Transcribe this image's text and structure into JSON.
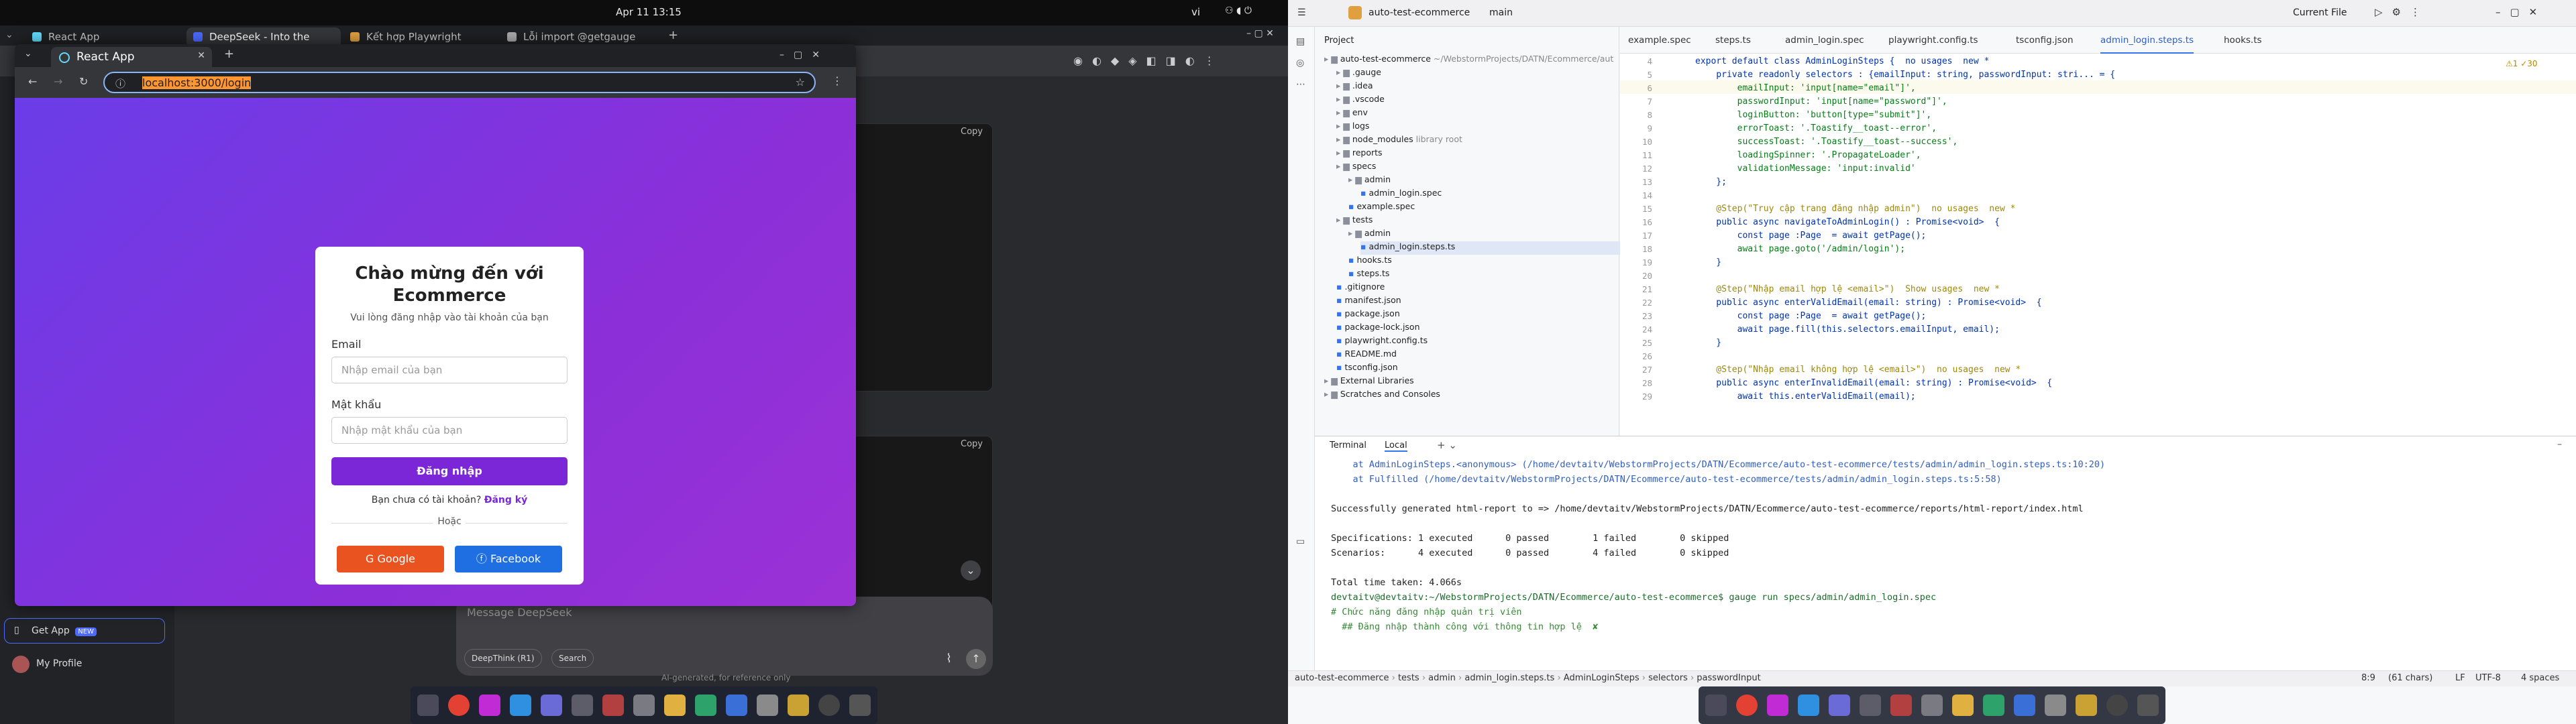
{
  "topbar": {
    "clock": "Apr 11  13:15",
    "lang": "vi"
  },
  "browser": {
    "tabs": [
      {
        "label": "React App",
        "color": "#61dafb"
      },
      {
        "label": "DeepSeek - Into the",
        "color": "#4d6bfe"
      },
      {
        "label": "Kết hợp Playwright",
        "color": "#e0a040"
      },
      {
        "label": "Lỗi import @getgauge",
        "color": "#aaaaaa"
      }
    ],
    "deepseek": {
      "copy_label": "Copy",
      "copy_label2": "Copy",
      "message_placeholder": "Message DeepSeek",
      "deepthink_label": "DeepThink (R1)",
      "search_label": "Search",
      "footer_note": "AI-generated, for reference only",
      "get_app_label": "Get App",
      "new_badge": "NEW",
      "profile_label": "My Profile"
    }
  },
  "popup": {
    "tab_title": "React App",
    "url": "localhost:3000/login",
    "login": {
      "title": "Chào mừng đến với Ecommerce",
      "subtitle": "Vui lòng đăng nhập vào tài khoản của bạn",
      "email_label": "Email",
      "email_placeholder": "Nhập email của bạn",
      "password_label": "Mật khẩu",
      "password_placeholder": "Nhập mật khẩu của bạn",
      "submit_label": "Đăng nhập",
      "no_account_text": "Bạn chưa có tài khoản?",
      "register_link": "Đăng ký",
      "or_text": "Hoặc",
      "google_label": "Google",
      "facebook_label": "Facebook"
    }
  },
  "ide": {
    "project_name": "auto-test-ecommerce",
    "branch": "main",
    "run_config": "Current File",
    "project_label": "Project",
    "tree": [
      {
        "name": "auto-test-ecommerce",
        "suffix": " ~/WebstormProjects/DATN/Ecommerce/aut",
        "depth": 0,
        "kind": "folder"
      },
      {
        "name": ".gauge",
        "depth": 1,
        "kind": "folder"
      },
      {
        "name": ".idea",
        "depth": 1,
        "kind": "folder"
      },
      {
        "name": ".vscode",
        "depth": 1,
        "kind": "folder"
      },
      {
        "name": "env",
        "depth": 1,
        "kind": "folder"
      },
      {
        "name": "logs",
        "depth": 1,
        "kind": "folder"
      },
      {
        "name": "node_modules",
        "suffix": " library root",
        "depth": 1,
        "kind": "folder"
      },
      {
        "name": "reports",
        "depth": 1,
        "kind": "folder"
      },
      {
        "name": "specs",
        "depth": 1,
        "kind": "folder"
      },
      {
        "name": "admin",
        "depth": 2,
        "kind": "folder"
      },
      {
        "name": "admin_login.spec",
        "depth": 3,
        "kind": "file"
      },
      {
        "name": "example.spec",
        "depth": 2,
        "kind": "file"
      },
      {
        "name": "tests",
        "depth": 1,
        "kind": "folder"
      },
      {
        "name": "admin",
        "depth": 2,
        "kind": "folder"
      },
      {
        "name": "admin_login.steps.ts",
        "depth": 3,
        "kind": "file"
      },
      {
        "name": "hooks.ts",
        "depth": 2,
        "kind": "file"
      },
      {
        "name": "steps.ts",
        "depth": 2,
        "kind": "file"
      },
      {
        "name": ".gitignore",
        "depth": 1,
        "kind": "file"
      },
      {
        "name": "manifest.json",
        "depth": 1,
        "kind": "file"
      },
      {
        "name": "package.json",
        "depth": 1,
        "kind": "file"
      },
      {
        "name": "package-lock.json",
        "depth": 1,
        "kind": "file"
      },
      {
        "name": "playwright.config.ts",
        "depth": 1,
        "kind": "file"
      },
      {
        "name": "README.md",
        "depth": 1,
        "kind": "file"
      },
      {
        "name": "tsconfig.json",
        "depth": 1,
        "kind": "file"
      },
      {
        "name": "External Libraries",
        "depth": 0,
        "kind": "folder"
      },
      {
        "name": "Scratches and Consoles",
        "depth": 0,
        "kind": "folder"
      }
    ],
    "editor_tabs": [
      "example.spec",
      "steps.ts",
      "admin_login.spec",
      "playwright.config.ts",
      "tsconfig.json",
      "admin_login.steps.ts",
      "hooks.ts"
    ],
    "active_tab": "admin_login.steps.ts",
    "inspection": "⚠1  ✓30",
    "code_lines": [
      {
        "n": "4",
        "t": "export default class AdminLoginSteps {  no usages  new *"
      },
      {
        "n": "5",
        "t": "    private readonly selectors : {emailInput: string, passwordInput: stri... = {"
      },
      {
        "n": "6",
        "t": "        emailInput: 'input[name=\"email\"]',"
      },
      {
        "n": "7",
        "t": "        passwordInput: 'input[name=\"password\"]',"
      },
      {
        "n": "8",
        "t": "        loginButton: 'button[type=\"submit\"]',"
      },
      {
        "n": "9",
        "t": "        errorToast: '.Toastify__toast--error',"
      },
      {
        "n": "10",
        "t": "        successToast: '.Toastify__toast--success',"
      },
      {
        "n": "11",
        "t": "        loadingSpinner: '.PropagateLoader',"
      },
      {
        "n": "12",
        "t": "        validationMessage: 'input:invalid'"
      },
      {
        "n": "13",
        "t": "    };"
      },
      {
        "n": "14",
        "t": ""
      },
      {
        "n": "15",
        "t": "    @Step(\"Truy cập trang đăng nhập admin\")  no usages  new *"
      },
      {
        "n": "16",
        "t": "    public async navigateToAdminLogin() : Promise<void>  {"
      },
      {
        "n": "17",
        "t": "        const page :Page  = await getPage();"
      },
      {
        "n": "18",
        "t": "        await page.goto('/admin/login');"
      },
      {
        "n": "19",
        "t": "    }"
      },
      {
        "n": "20",
        "t": ""
      },
      {
        "n": "21",
        "t": "    @Step(\"Nhập email hợp lệ <email>\")  Show usages  new *"
      },
      {
        "n": "22",
        "t": "    public async enterValidEmail(email: string) : Promise<void>  {"
      },
      {
        "n": "23",
        "t": "        const page :Page  = await getPage();"
      },
      {
        "n": "24",
        "t": "        await page.fill(this.selectors.emailInput, email);"
      },
      {
        "n": "25",
        "t": "    }"
      },
      {
        "n": "26",
        "t": ""
      },
      {
        "n": "27",
        "t": "    @Step(\"Nhập email không hợp lệ <email>\")  no usages  new *"
      },
      {
        "n": "28",
        "t": "    public async enterInvalidEmail(email: string) : Promise<void>  {"
      },
      {
        "n": "29",
        "t": "        await this.enterValidEmail(email);"
      }
    ],
    "terminal": {
      "tab_label": "Terminal",
      "local_label": "Local",
      "lines": [
        {
          "t": "    at AdminLoginSteps.<anonymous> (/home/devtaitv/WebstormProjects/DATN/Ecommerce/auto-test-ecommerce/tests/admin/admin_login.steps.ts:10:20)",
          "k": "link"
        },
        {
          "t": "    at Fulfilled (/home/devtaitv/WebstormProjects/DATN/Ecommerce/auto-test-ecommerce/tests/admin/admin_login.steps.ts:5:58)",
          "k": "link"
        },
        {
          "t": "",
          "k": ""
        },
        {
          "t": "Successfully generated html-report to => /home/devtaitv/WebstormProjects/DATN/Ecommerce/auto-test-ecommerce/reports/html-report/index.html",
          "k": ""
        },
        {
          "t": "",
          "k": ""
        },
        {
          "t": "Specifications: 1 executed      0 passed        1 failed        0 skipped",
          "k": ""
        },
        {
          "t": "Scenarios:      4 executed      0 passed        4 failed        0 skipped",
          "k": ""
        },
        {
          "t": "",
          "k": ""
        },
        {
          "t": "Total time taken: 4.066s",
          "k": ""
        },
        {
          "t": "devtaitv@devtaitv:~/WebstormProjects/DATN/Ecommerce/auto-test-ecommerce$ gauge run specs/admin/admin_login.spec",
          "k": "prompt"
        },
        {
          "t": "# Chức năng đăng nhập quản trị viên",
          "k": "green"
        },
        {
          "t": "  ## Đăng nhập thành công với thông tin hợp lệ  ✘",
          "k": "green"
        }
      ]
    },
    "status_bar": {
      "breadcrumb": [
        "auto-test-ecommerce",
        "tests",
        "admin",
        "admin_login.steps.ts",
        "AdminLoginSteps",
        "selectors",
        "passwordInput"
      ],
      "position": "8:9",
      "indent_info": "(61 chars)",
      "line_sep": "LF",
      "encoding": "UTF-8",
      "indent": "4 spaces"
    }
  }
}
